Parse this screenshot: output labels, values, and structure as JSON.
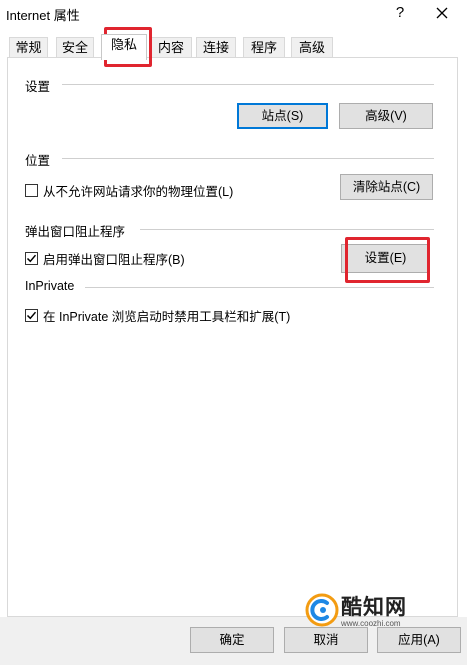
{
  "window": {
    "title": "Internet 属性",
    "help_glyph": "?"
  },
  "tabs": [
    {
      "label": "常规"
    },
    {
      "label": "安全"
    },
    {
      "label": "隐私"
    },
    {
      "label": "内容"
    },
    {
      "label": "连接"
    },
    {
      "label": "程序"
    },
    {
      "label": "高级"
    }
  ],
  "active_tab": "隐私",
  "settings_section": {
    "label": "设置",
    "sites_button": "站点(S)",
    "advanced_button": "高级(V)"
  },
  "location_section": {
    "label": "位置",
    "checkbox_label": "从不允许网站请求你的物理位置(L)",
    "checked": false,
    "clear_button": "清除站点(C)"
  },
  "popup_section": {
    "label": "弹出窗口阻止程序",
    "checkbox_label": "启用弹出窗口阻止程序(B)",
    "checked": true,
    "settings_button": "设置(E)"
  },
  "inprivate_section": {
    "label": "InPrivate",
    "checkbox_label": "在 InPrivate 浏览启动时禁用工具栏和扩展(T)",
    "checked": true
  },
  "footer": {
    "ok_button": "确定",
    "cancel_button": "取消",
    "apply_button": "应用(A)"
  },
  "watermark": {
    "brand": "酷知网",
    "url": "www.coozhi.com"
  },
  "colors": {
    "highlight_red": "#e0252f",
    "focus_blue": "#0078d7",
    "button_face": "#e1e1e1"
  }
}
